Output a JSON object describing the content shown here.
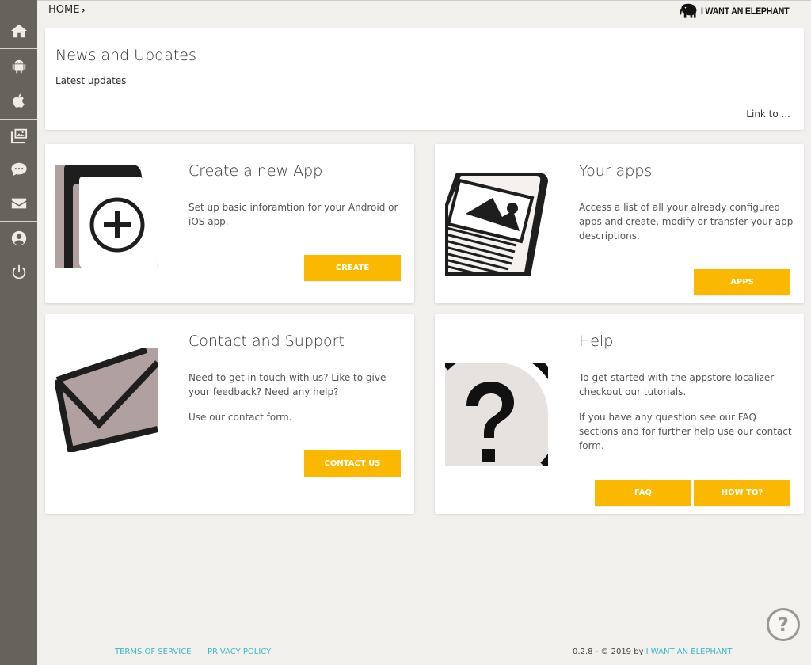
{
  "breadcrumb": {
    "home": "HOME",
    "separator": "›"
  },
  "brand": {
    "name": "I WANT AN ELEPHANT",
    "logo_icon": "elephant-icon"
  },
  "sidebar": {
    "items": [
      {
        "icon": "home-icon"
      },
      {
        "icon": "android-icon"
      },
      {
        "icon": "apple-icon"
      },
      {
        "icon": "gallery-icon"
      },
      {
        "icon": "chat-icon"
      },
      {
        "icon": "mail-icon"
      },
      {
        "icon": "user-icon"
      },
      {
        "icon": "power-icon"
      }
    ],
    "background": "#66625c"
  },
  "news": {
    "title": "News and Updates",
    "subtitle": "Latest updates",
    "link": "Link to ..."
  },
  "cards": {
    "create": {
      "title": "Create a new App",
      "text": "Set up basic inforamtion for your Android or iOS app.",
      "button": "CREATE",
      "icon": "add-app-icon"
    },
    "apps": {
      "title": "Your apps",
      "text": "Access a list of all your already configured apps and create, modify or transfer your app descriptions.",
      "button": "APPS",
      "icon": "app-description-icon"
    },
    "contact": {
      "title": "Contact and Support",
      "text1": "Need to get in touch with us? Like to give your feedback? Need any help?",
      "text2": "Use our contact form.",
      "button": "CONTACT US",
      "icon": "envelope-icon"
    },
    "help": {
      "title": "Help",
      "text1": "To get started with the appstore localizer checkout our tutorials.",
      "text2": "If you have any question see our FAQ sections and for further help use our contact form.",
      "button_faq": "FAQ",
      "button_howto": "HOW TO?",
      "icon": "question-mark-icon"
    }
  },
  "footer": {
    "terms": "TERMS OF SERVICE",
    "privacy": "PRIVACY POLICY",
    "copyright": "0.2.8 - © 2019 by",
    "brand": "I WANT AN ELEPHANT"
  },
  "floating_help": {
    "icon": "help-icon",
    "glyph": "?"
  },
  "colors": {
    "accent": "#fbb800",
    "link": "#3fb7c8",
    "background": "#f1f0ed",
    "illustration_fill": "#b0a09f"
  }
}
